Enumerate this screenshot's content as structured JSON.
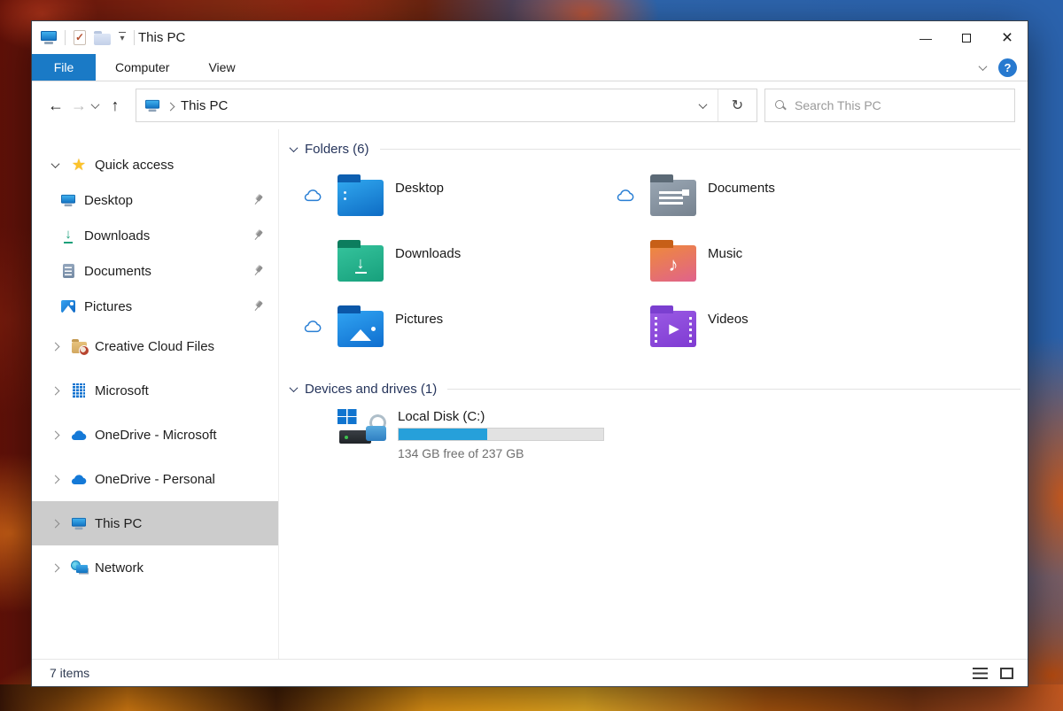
{
  "titlebar": {
    "title": "This PC"
  },
  "icons": {
    "back": "←",
    "forward": "→",
    "up": "↑",
    "refresh": "↻",
    "minimize": "—",
    "close": "×",
    "help": "?",
    "star": "★",
    "download_arrow": "↓",
    "music_note": "♪",
    "play": "▶"
  },
  "ribbon": {
    "tabs": [
      {
        "label": "File"
      },
      {
        "label": "Computer"
      },
      {
        "label": "View"
      }
    ]
  },
  "navbar": {
    "address_crumb": "This PC",
    "search_placeholder": "Search This PC"
  },
  "sidebar": {
    "items": [
      {
        "label": "Quick access"
      },
      {
        "label": "Desktop"
      },
      {
        "label": "Downloads"
      },
      {
        "label": "Documents"
      },
      {
        "label": "Pictures"
      },
      {
        "label": "Creative Cloud Files"
      },
      {
        "label": "Microsoft"
      },
      {
        "label": "OneDrive - Microsoft"
      },
      {
        "label": "OneDrive - Personal"
      },
      {
        "label": "This PC"
      },
      {
        "label": "Network"
      }
    ]
  },
  "main": {
    "sections": [
      {
        "title": "Folders (6)"
      },
      {
        "title": "Devices and drives (1)"
      }
    ],
    "folders": [
      {
        "name": "Desktop",
        "cloud": true
      },
      {
        "name": "Downloads",
        "cloud": false
      },
      {
        "name": "Pictures",
        "cloud": true
      },
      {
        "name": "Documents",
        "cloud": true
      },
      {
        "name": "Music",
        "cloud": false
      },
      {
        "name": "Videos",
        "cloud": false
      }
    ],
    "drive": {
      "name": "Local Disk (C:)",
      "free_text": "134 GB free of 237 GB",
      "used_percent": 43.5
    }
  },
  "statusbar": {
    "items_text": "7 items"
  },
  "colors": {
    "accent_blue": "#1a7ac6",
    "selection_gray": "#cccccc",
    "disk_bar_fill": "#26a0da",
    "header_navy": "#26355c"
  }
}
